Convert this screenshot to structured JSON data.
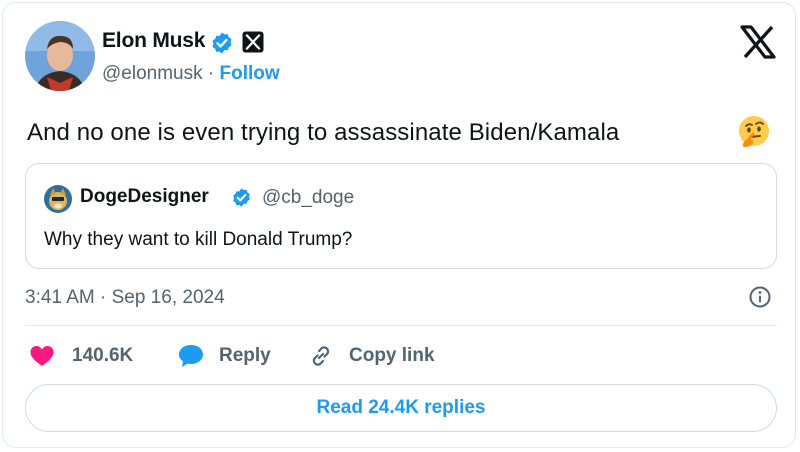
{
  "tweet": {
    "author_name": "Elon Musk",
    "author_handle": "@elonmusk",
    "separator": "·",
    "follow_label": "Follow",
    "text": "And no one is even trying to assassinate Biden/Kamala",
    "emoji": "thinking-face-icon",
    "timestamp": "3:41 AM · Sep 16, 2024"
  },
  "quoted_tweet": {
    "author_name": "DogeDesigner",
    "author_handle": "@cb_doge",
    "text": "Why they want to kill Donald Trump?"
  },
  "actions": {
    "like_count": "140.6K",
    "reply_label": "Reply",
    "copy_link_label": "Copy link"
  },
  "footer": {
    "read_replies_label": "Read 24.4K replies"
  },
  "colors": {
    "accent": "#1d9bf0",
    "like": "#f91880",
    "muted_text": "#536471",
    "border": "#cfd9de"
  }
}
